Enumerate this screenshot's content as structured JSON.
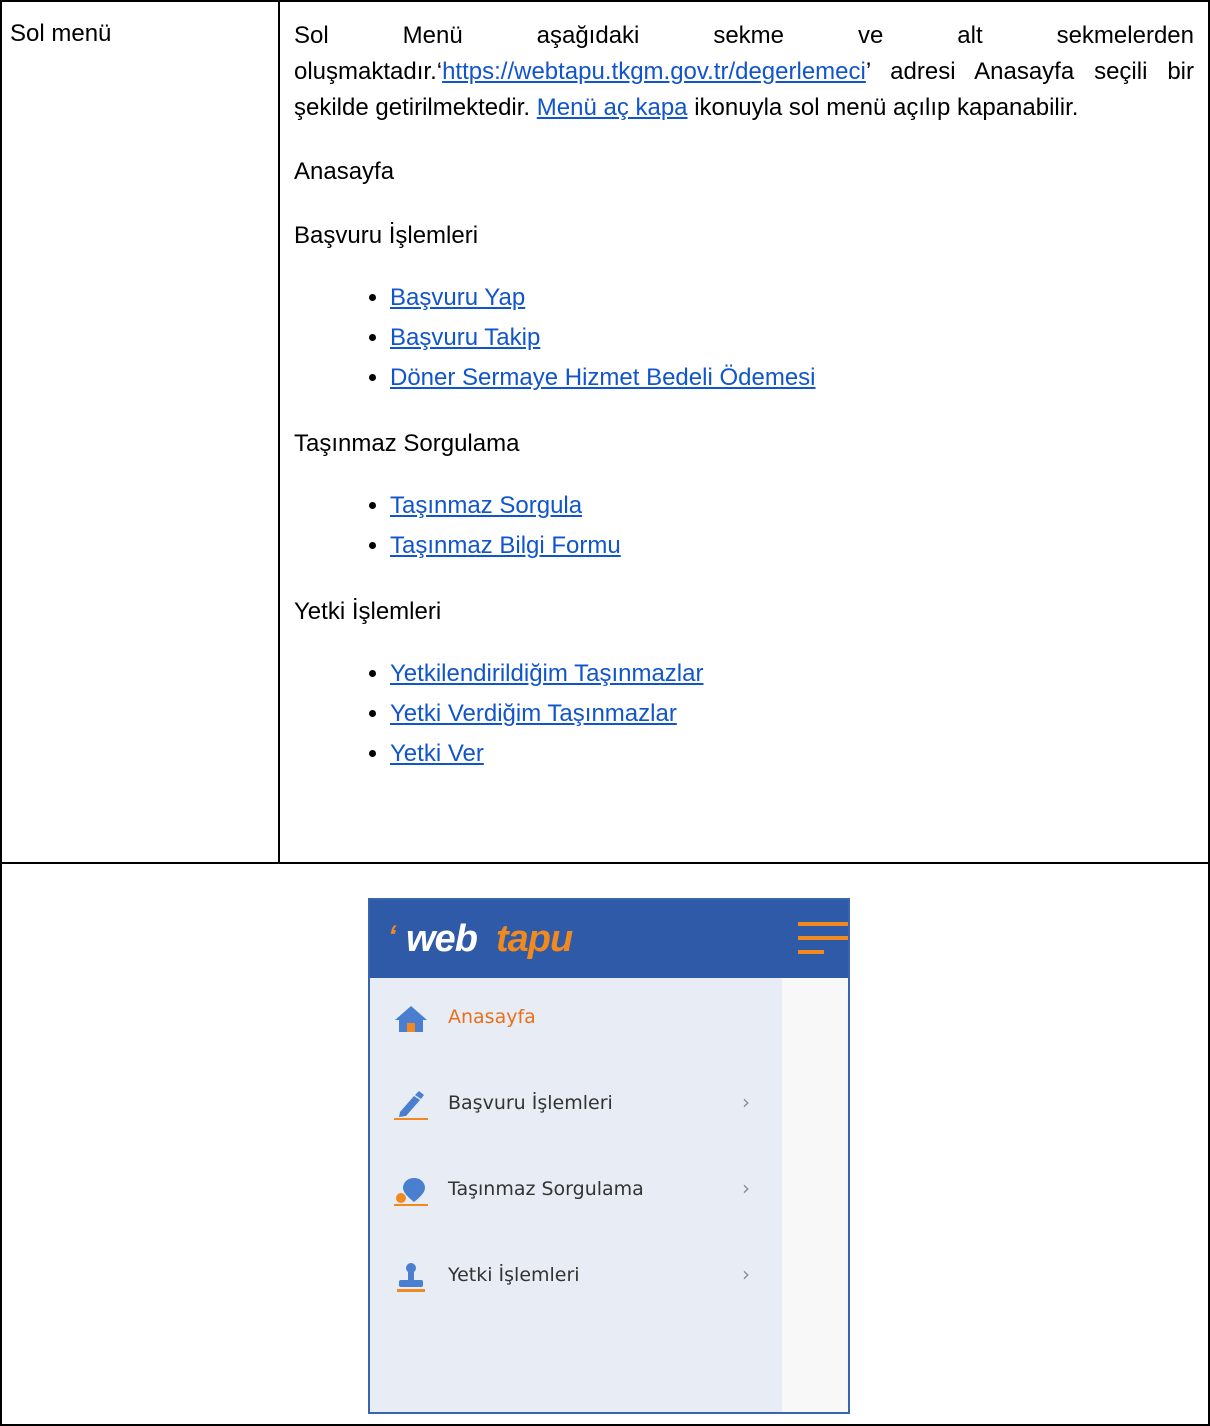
{
  "row1": {
    "label": "Sol menü",
    "intro": {
      "part1": "Sol Menü aşağıdaki sekme ve alt sekmelerden oluşmaktadır.‘",
      "url": "https://webtapu.tkgm.gov.tr/degerlemeci",
      "part2": "’ adresi Anasayfa seçili bir şekilde getirilmektedir. ",
      "toggle_link": "Menü aç kapa",
      "part3": " ikonuyla sol menü açılıp kapanabilir."
    },
    "sections": [
      {
        "title": "Anasayfa",
        "links": []
      },
      {
        "title": "Başvuru İşlemleri",
        "links": [
          "Başvuru Yap",
          "Başvuru Takip",
          "Döner Sermaye Hizmet Bedeli Ödemesi"
        ]
      },
      {
        "title": "Taşınmaz Sorgulama",
        "links": [
          "Taşınmaz Sorgula",
          "Taşınmaz Bilgi Formu"
        ]
      },
      {
        "title": "Yetki İşlemleri",
        "links": [
          "Yetkilendirildiğim Taşınmazlar",
          "Yetki Verdiğim Taşınmazlar",
          "Yetki Ver"
        ]
      }
    ]
  },
  "screenshot": {
    "logo_part1": "web",
    "logo_part2": "tapu",
    "menu": [
      {
        "label": "Anasayfa",
        "icon": "home-icon",
        "active": true,
        "chevron": ""
      },
      {
        "label": "Başvuru İşlemleri",
        "icon": "pen-icon",
        "active": false,
        "chevron": "›"
      },
      {
        "label": "Taşınmaz Sorgulama",
        "icon": "map-pin-icon",
        "active": false,
        "chevron": "›"
      },
      {
        "label": "Yetki İşlemleri",
        "icon": "stamp-icon",
        "active": false,
        "chevron": "›"
      }
    ],
    "colors": {
      "header": "#2f5aa7",
      "accent": "#f08a1e",
      "menu_bg": "#e8edf5"
    }
  }
}
